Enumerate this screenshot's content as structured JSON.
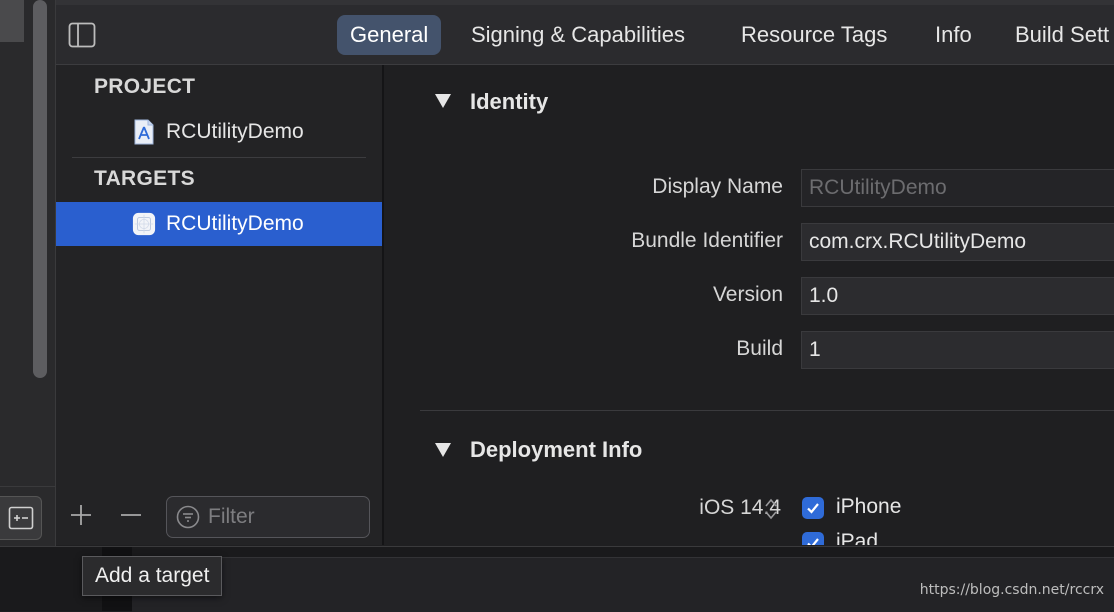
{
  "tabs": [
    {
      "label": "General",
      "active": true
    },
    {
      "label": "Signing & Capabilities",
      "active": false
    },
    {
      "label": "Resource Tags",
      "active": false
    },
    {
      "label": "Info",
      "active": false
    },
    {
      "label": "Build Sett",
      "active": false
    }
  ],
  "navigator": {
    "project_header": "PROJECT",
    "project_item": "RCUtilityDemo",
    "targets_header": "TARGETS",
    "target_item": "RCUtilityDemo",
    "filter_placeholder": "Filter"
  },
  "identity": {
    "title": "Identity",
    "display_name_label": "Display Name",
    "display_name_value": "RCUtilityDemo",
    "bundle_id_label": "Bundle Identifier",
    "bundle_id_value": "com.crx.RCUtilityDemo",
    "version_label": "Version",
    "version_value": "1.0",
    "build_label": "Build",
    "build_value": "1"
  },
  "deployment": {
    "title": "Deployment Info",
    "ios_version": "iOS 14.4",
    "devices": [
      {
        "label": "iPhone",
        "checked": true
      },
      {
        "label": "iPad",
        "checked": true
      }
    ]
  },
  "tooltip": "Add a target",
  "watermark": "https://blog.csdn.net/rccrx",
  "colors": {
    "accent": "#2a5fcf",
    "active_tab": "#44536c",
    "checkbox": "#2f6bd8"
  }
}
